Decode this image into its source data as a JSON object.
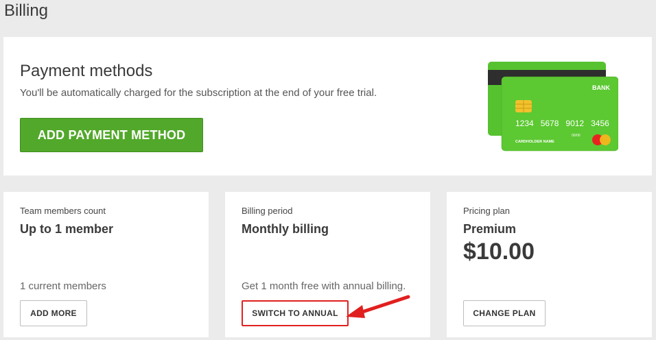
{
  "page": {
    "title": "Billing"
  },
  "payment_methods": {
    "title": "Payment methods",
    "subtitle": "You'll be automatically charged for the subscription at the end of your free trial.",
    "add_button": "ADD PAYMENT METHOD",
    "card_illustration": {
      "bank_label": "BANK",
      "card_number": "1234   5678   9012   3456",
      "holder_label": "CARDHOLDER NAME",
      "expiry": "00/00",
      "color": "#56c22f"
    }
  },
  "team": {
    "label": "Team members count",
    "value": "Up to 1 member",
    "note": "1 current members",
    "button": "ADD MORE"
  },
  "billing": {
    "label": "Billing period",
    "value": "Monthly billing",
    "note": "Get 1 month free with annual billing.",
    "button": "SWITCH TO ANNUAL"
  },
  "pricing": {
    "label": "Pricing plan",
    "value": "Premium",
    "price": "$10.00",
    "button": "CHANGE PLAN"
  },
  "colors": {
    "primary_green": "#52a82a",
    "highlight_red": "#e0201f"
  },
  "annotation": {
    "icon": "red-arrow-icon"
  }
}
